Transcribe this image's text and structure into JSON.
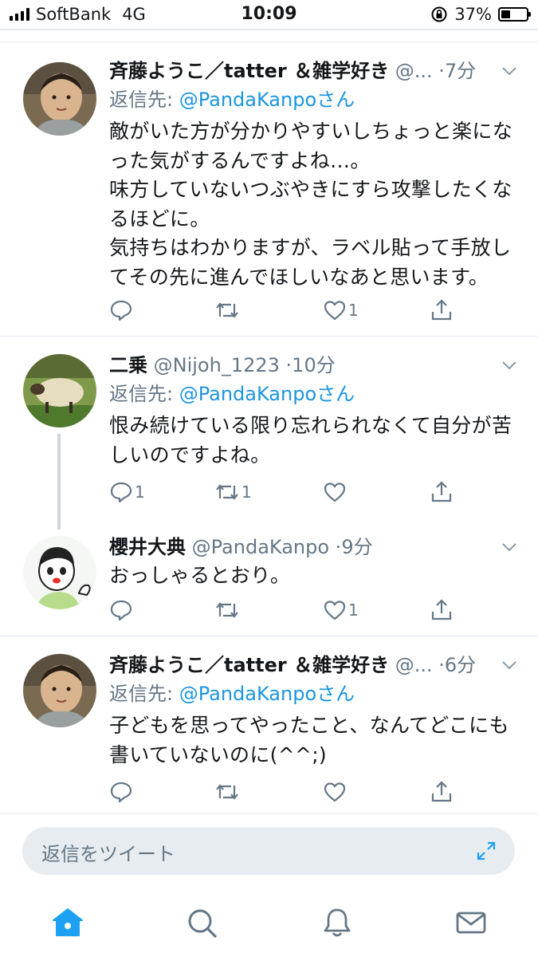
{
  "status_bar": {
    "carrier": "SoftBank",
    "network": "4G",
    "time": "10:09",
    "battery": "37%",
    "battery_level": 0.37
  },
  "tweets": [
    {
      "name": "斉藤ようこ／tatter ＆雑学好き",
      "handle": "@...",
      "time": "7分",
      "reply_prefix": "返信先:",
      "reply_to": "@PandaKanpo",
      "reply_suffix": "さん",
      "text": "敵がいた方が分かりやすいしちょっと楽にな\nった気がするんですよね…。\n味方していないつぶやきにすら攻撃したくな\nるほどに。\n気持ちはわかりますが、ラベル貼って手放し\nてその先に進んでほしいなあと思います。",
      "replies": "",
      "retweets": "",
      "likes": "1"
    },
    {
      "name": "二乗",
      "handle": "@Nijoh_1223",
      "time": "10分",
      "reply_prefix": "返信先:",
      "reply_to": "@PandaKanpo",
      "reply_suffix": "さん",
      "text": "恨み続けている限り忘れられなくて自分が苦\nしいのですよね。",
      "replies": "1",
      "retweets": "1",
      "likes": ""
    },
    {
      "name": "櫻井大典",
      "handle": "@PandaKanpo",
      "time": "9分",
      "text": "おっしゃるとおり。",
      "replies": "",
      "retweets": "",
      "likes": "1"
    },
    {
      "name": "斉藤ようこ／tatter ＆雑学好き",
      "handle": "@...",
      "time": "6分",
      "reply_prefix": "返信先:",
      "reply_to": "@PandaKanpo",
      "reply_suffix": "さん",
      "text": "子どもを思ってやったこと、なんてどこにも\n書いていないのに(^^;)",
      "replies": "",
      "retweets": "",
      "likes": ""
    }
  ],
  "composer": {
    "placeholder": "返信をツイート"
  },
  "tabs": [
    "home-icon",
    "search-icon",
    "notifications-icon",
    "messages-icon"
  ],
  "colors": {
    "accent": "#1da1f2",
    "muted": "#657786",
    "text": "#14171a"
  }
}
